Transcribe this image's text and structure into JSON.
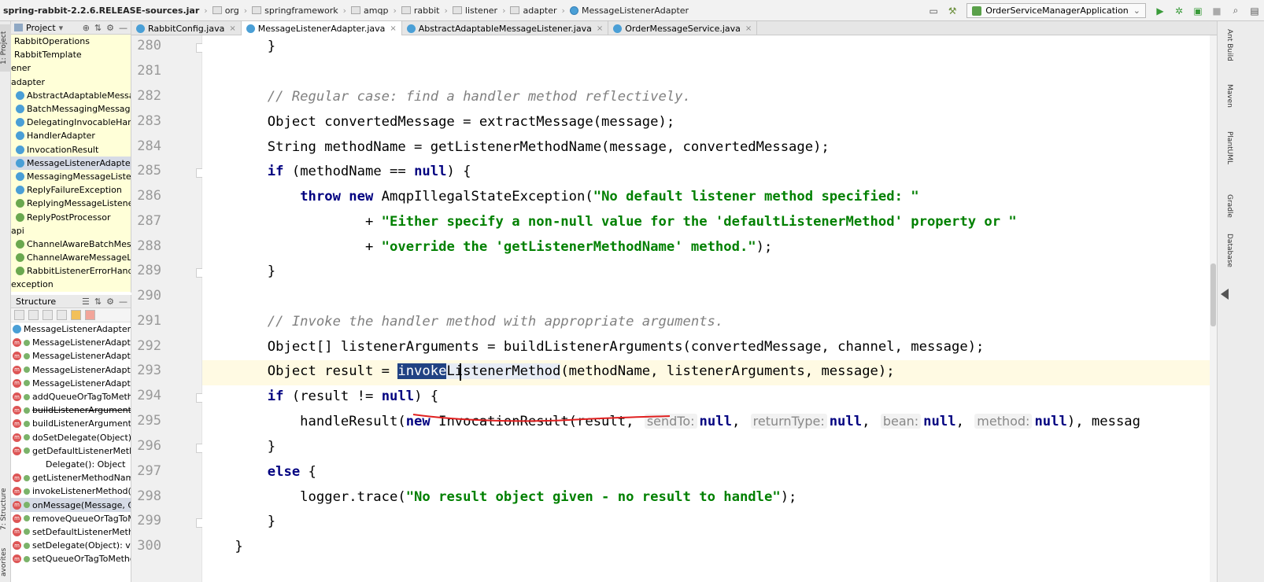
{
  "breadcrumb": [
    "spring-rabbit-2.2.6.RELEASE-sources.jar",
    "org",
    "springframework",
    "amqp",
    "rabbit",
    "listener",
    "adapter",
    "MessageListenerAdapter"
  ],
  "run_config": "OrderServiceManagerApplication",
  "left_strip": {
    "project": "1: Project",
    "structure": "7: Structure",
    "favorites": "avorites"
  },
  "project_panel": {
    "title": "Project",
    "items": [
      {
        "label": "RabbitOperations",
        "kind": "plain"
      },
      {
        "label": "RabbitTemplate",
        "kind": "plain"
      },
      {
        "label": "ener",
        "kind": "plain"
      },
      {
        "label": "adapter",
        "kind": "plain"
      },
      {
        "label": "AbstractAdaptableMessage",
        "kind": "class"
      },
      {
        "label": "BatchMessagingMessageLi",
        "kind": "class"
      },
      {
        "label": "DelegatingInvocableHandle",
        "kind": "class"
      },
      {
        "label": "HandlerAdapter",
        "kind": "class"
      },
      {
        "label": "InvocationResult",
        "kind": "class"
      },
      {
        "label": "MessageListenerAdapter",
        "kind": "class",
        "selected": true
      },
      {
        "label": "MessagingMessageListener",
        "kind": "class"
      },
      {
        "label": "ReplyFailureException",
        "kind": "class"
      },
      {
        "label": "ReplyingMessageListener",
        "kind": "interface"
      },
      {
        "label": "ReplyPostProcessor",
        "kind": "interface"
      },
      {
        "label": "api",
        "kind": "plain"
      },
      {
        "label": "ChannelAwareBatchMessag",
        "kind": "interface"
      },
      {
        "label": "ChannelAwareMessageListe",
        "kind": "interface"
      },
      {
        "label": "RabbitListenerErrorHandler",
        "kind": "interface"
      },
      {
        "label": "exception",
        "kind": "plain"
      }
    ]
  },
  "structure_panel": {
    "title": "Structure",
    "root": "MessageListenerAdapter",
    "items": [
      {
        "label": "MessageListenerAdapter("
      },
      {
        "label": "MessageListenerAdapter("
      },
      {
        "label": "MessageListenerAdapter("
      },
      {
        "label": "MessageListenerAdapter("
      },
      {
        "label": "addQueueOrTagToMetho"
      },
      {
        "label": "buildListenerArguments(O",
        "strike": true
      },
      {
        "label": "buildListenerArguments(O"
      },
      {
        "label": "doSetDelegate(Object): vo"
      },
      {
        "label": "getDefaultListenerMethod"
      },
      {
        "label": "Delegate(): Object",
        "indent": true
      },
      {
        "label": "getListenerMethodName("
      },
      {
        "label": "invokeListenerMethod(Str"
      },
      {
        "label": "onMessage(Message, Cha",
        "selected": true
      },
      {
        "label": "removeQueueOrTagToMe"
      },
      {
        "label": "setDefaultListenerMethod"
      },
      {
        "label": "setDelegate(Object): void"
      },
      {
        "label": "setQueueOrTagToMethoc"
      }
    ]
  },
  "tabs": [
    {
      "label": "RabbitConfig.java",
      "active": false
    },
    {
      "label": "MessageListenerAdapter.java",
      "active": true
    },
    {
      "label": "AbstractAdaptableMessageListener.java",
      "active": false
    },
    {
      "label": "OrderMessageService.java",
      "active": false
    }
  ],
  "right_strip": [
    "Ant Build",
    "Maven",
    "PlantUML",
    "Gradle",
    "Database"
  ],
  "code": {
    "line_numbers": [
      "280",
      "281",
      "282",
      "283",
      "284",
      "285",
      "286",
      "287",
      "288",
      "289",
      "290",
      "291",
      "292",
      "293",
      "294",
      "295",
      "296",
      "297",
      "298",
      "299",
      "300"
    ],
    "l280": "        }",
    "l282": "        // Regular case: find a handler method reflectively.",
    "l283": "        Object convertedMessage = extractMessage(message);",
    "l284": "        String methodName = getListenerMethodName(message, convertedMessage);",
    "l285a": "        ",
    "l285kw1": "if",
    "l285b": " (methodName == ",
    "l285kw2": "null",
    "l285c": ") {",
    "l286a": "            ",
    "l286kw1": "throw new",
    "l286b": " AmqpIllegalStateException(",
    "l286s": "\"No default listener method specified: \"",
    "l287a": "                    + ",
    "l287s": "\"Either specify a non-null value for the 'defaultListenerMethod' property or \"",
    "l288a": "                    + ",
    "l288s": "\"override the 'getListenerMethodName' method.\"",
    "l288b": ");",
    "l289": "        }",
    "l291": "        // Invoke the handler method with appropriate arguments.",
    "l292": "        Object[] listenerArguments = buildListenerArguments(convertedMessage, channel, message);",
    "l293a": "        Object result = ",
    "l293sel": "invoke",
    "l293use": "ListenerMethod",
    "l293b": "(methodName, listenerArguments, message);",
    "l294a": "        ",
    "l294kw1": "if",
    "l294b": " (result != ",
    "l294kw2": "null",
    "l294c": ") {",
    "l295a": "            handleResult(",
    "l295kw1": "new",
    "l295b": " InvocationResult(result,",
    "hint_sendTo": "sendTo:",
    "hint_returnType": "returnType:",
    "hint_bean": "bean:",
    "hint_method": "method:",
    "null_kw": "null",
    "l295tail": "), messag",
    "l296": "        }",
    "l297a": "        ",
    "l297kw": "else",
    "l297b": " {",
    "l298a": "            logger.trace(",
    "l298s": "\"No result object given - no result to handle\"",
    "l298b": ");",
    "l299": "        }",
    "l300": "    }"
  }
}
